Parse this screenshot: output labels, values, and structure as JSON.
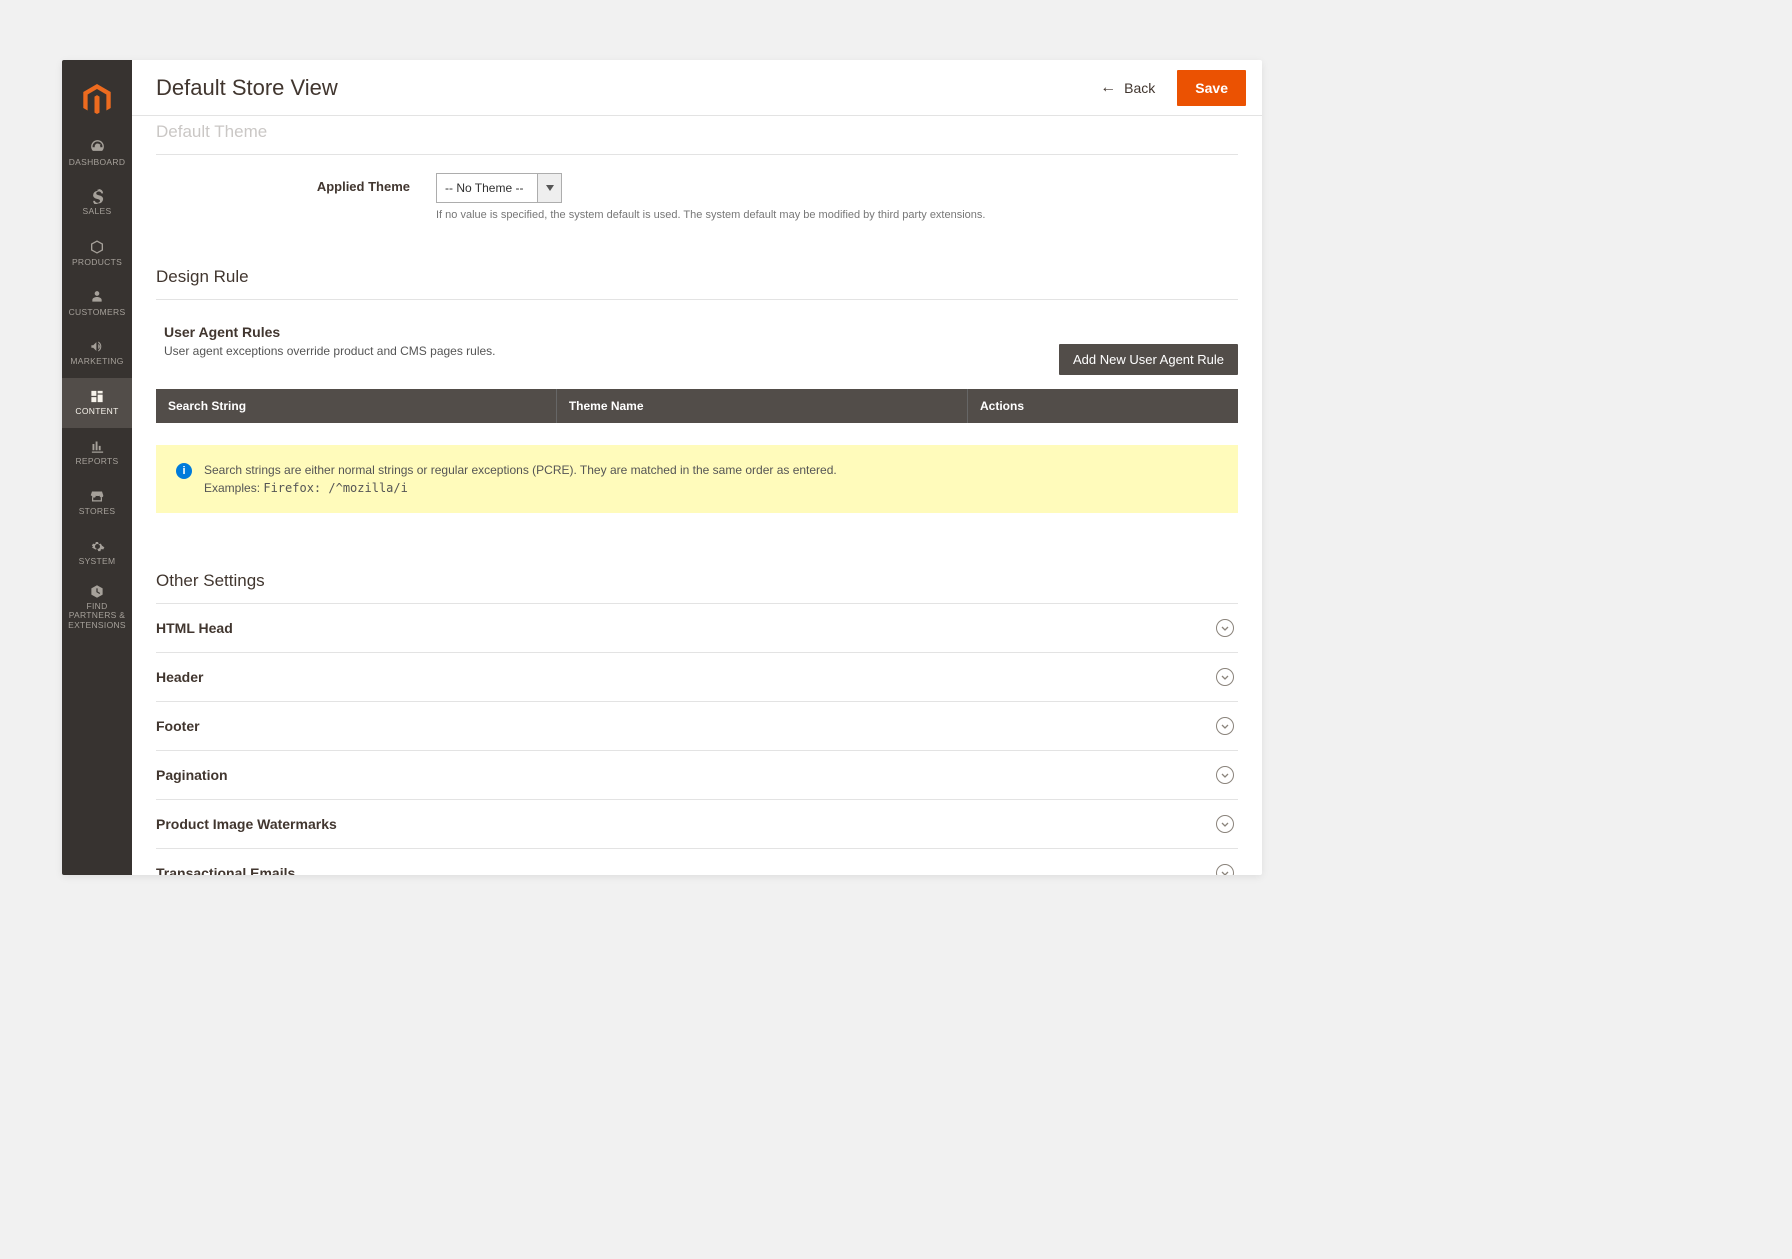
{
  "header": {
    "title": "Default Store View",
    "back_label": "Back",
    "save_label": "Save"
  },
  "sidebar": {
    "items": [
      {
        "label": "DASHBOARD"
      },
      {
        "label": "SALES"
      },
      {
        "label": "PRODUCTS"
      },
      {
        "label": "CUSTOMERS"
      },
      {
        "label": "MARKETING"
      },
      {
        "label": "CONTENT"
      },
      {
        "label": "REPORTS"
      },
      {
        "label": "STORES"
      },
      {
        "label": "SYSTEM"
      },
      {
        "label": "FIND PARTNERS & EXTENSIONS"
      }
    ]
  },
  "default_theme": {
    "section_title": "Default Theme",
    "field_label": "Applied Theme",
    "selected": "-- No Theme --",
    "hint": "If no value is specified, the system default is used. The system default may be modified by third party extensions."
  },
  "design_rule": {
    "section_title": "Design Rule",
    "ua_title": "User Agent Rules",
    "ua_desc": "User agent exceptions override product and CMS pages rules.",
    "add_btn": "Add New User Agent Rule",
    "columns": [
      "Search String",
      "Theme Name",
      "Actions"
    ],
    "note_line1": "Search strings are either normal strings or regular exceptions (PCRE). They are matched in the same order as entered.",
    "note_line2_prefix": "Examples: ",
    "note_line2_code": "Firefox: /^mozilla/i"
  },
  "other_settings": {
    "section_title": "Other Settings",
    "items": [
      "HTML Head",
      "Header",
      "Footer",
      "Pagination",
      "Product Image Watermarks",
      "Transactional Emails"
    ]
  }
}
